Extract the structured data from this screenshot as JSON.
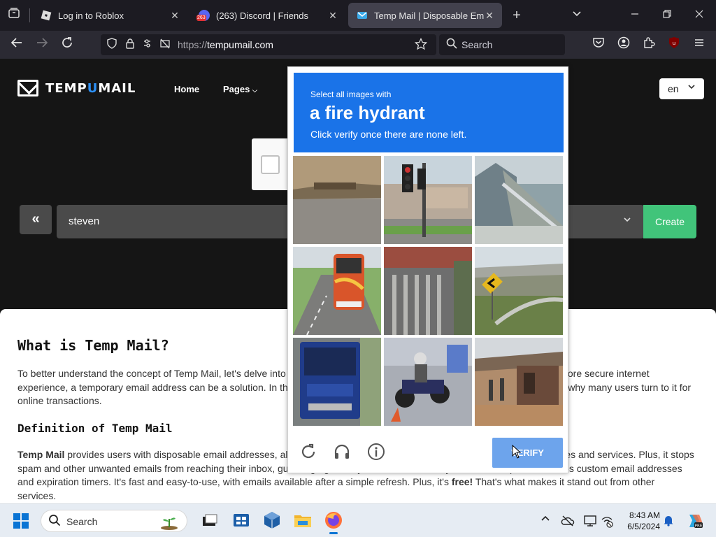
{
  "tabs": [
    {
      "title": "Log in to Roblox",
      "favicon": "roblox-icon",
      "active": false
    },
    {
      "title": "(263) Discord | Friends",
      "favicon": "discord-icon",
      "badge": "263",
      "active": false
    },
    {
      "title": "Temp Mail | Disposable Email A",
      "favicon": "tempmail-icon",
      "active": true
    }
  ],
  "window_controls": {
    "new_tab": "+",
    "list_all": "⌄",
    "minimize": "—",
    "restore": "❐",
    "close": "✕"
  },
  "toolbar": {
    "url_protocol": "https://",
    "url_host": "tempumail.com",
    "search_placeholder": "Search",
    "extension_badge": "8"
  },
  "site": {
    "brand_pre": "TEMP",
    "brand_u": "U",
    "brand_post": "MAIL",
    "nav": [
      "Home",
      "Pages"
    ],
    "lang": "en",
    "email_value": "steven",
    "create_label": "Create",
    "prev_label": "«",
    "accent_color": "#41c47a"
  },
  "content": {
    "h1": "What is Temp Mail?",
    "p1": "To better understand the concept of Temp Mail, let's delve into the definition and advantages. As people strive for a safer and more secure internet experience, a temporary email address can be a solution. In this article, we discuss what Temp Mail is and explore the reasons why many users turn to it for online transactions.",
    "h2": "Definition of Temp Mail",
    "p2_strong": "Temp Mail",
    "p2_text": " provides users with disposable email addresses, allowing them to hide their true identity when signing up for websites and services. Plus, it stops spam and other unwanted emails from reaching their inbox, guarding against cyber threats. Not only that, but Temp Mail features custom email addresses and expiration timers. It's fast and easy-to-use, with emails available after a simple refresh. Plus, it's ",
    "p2_free": "free!",
    "p2_end": " That's what makes it stand out from other services."
  },
  "captcha": {
    "line1": "Select all images with",
    "target": "a fire hydrant",
    "line3": "Click verify once there are none left.",
    "verify_label": "VERIFY",
    "header_color": "#1a73e8",
    "tiles": [
      "dirt-road-tile",
      "traffic-light-tile",
      "bridge-railing-tile",
      "bus-tile",
      "gate-tile",
      "overpass-tile",
      "truck-tile",
      "motorcycle-tile",
      "street-shop-tile"
    ]
  },
  "taskbar": {
    "search_placeholder": "Search",
    "time": "8:43 AM",
    "date": "6/5/2024"
  }
}
